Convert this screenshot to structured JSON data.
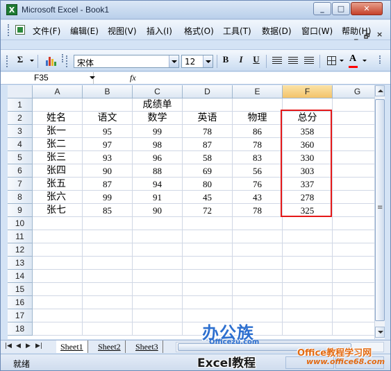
{
  "window": {
    "app_icon": "X",
    "title": "Microsoft Excel - Book1",
    "min_label": "_",
    "max_label": "□",
    "close_label": "✕"
  },
  "menu": {
    "items": [
      "文件(F)",
      "编辑(E)",
      "视图(V)",
      "插入(I)",
      "格式(O)",
      "工具(T)",
      "数据(D)",
      "窗口(W)",
      "帮助(H)"
    ],
    "ctrl_min": "_",
    "ctrl_restore": "🗗",
    "ctrl_close": "×"
  },
  "toolbar": {
    "autosum": "Σ",
    "font_name": "宋体",
    "font_size": "12",
    "bold": "B",
    "italic": "I",
    "underline": "U",
    "font_color_label": "A",
    "font_color_hex": "#ff0000"
  },
  "formula_bar": {
    "name_box": "F35",
    "fx": "fx"
  },
  "grid": {
    "columns": [
      "A",
      "B",
      "C",
      "D",
      "E",
      "F",
      "G"
    ],
    "selected_column": "F",
    "rows": [
      "1",
      "2",
      "3",
      "4",
      "5",
      "6",
      "7",
      "8",
      "9",
      "10",
      "11",
      "12",
      "13",
      "14",
      "15",
      "16",
      "17",
      "18"
    ],
    "title": "成绩单",
    "headers": [
      "姓名",
      "语文",
      "数学",
      "英语",
      "物理",
      "总分"
    ],
    "data": [
      [
        "张一",
        "95",
        "99",
        "78",
        "86",
        "358"
      ],
      [
        "张二",
        "97",
        "98",
        "87",
        "78",
        "360"
      ],
      [
        "张三",
        "93",
        "96",
        "58",
        "83",
        "330"
      ],
      [
        "张四",
        "90",
        "88",
        "69",
        "56",
        "303"
      ],
      [
        "张五",
        "87",
        "94",
        "80",
        "76",
        "337"
      ],
      [
        "张六",
        "99",
        "91",
        "45",
        "43",
        "278"
      ],
      [
        "张七",
        "85",
        "90",
        "72",
        "78",
        "325"
      ]
    ],
    "highlight_color": "#e51818"
  },
  "sheets": {
    "tabs": [
      "Sheet1",
      "Sheet2",
      "Sheet3"
    ],
    "active": "Sheet1"
  },
  "status": {
    "text": "就绪"
  },
  "watermarks": {
    "bangongzu": "办公族",
    "officezu_url": "Officezu.com",
    "excel_jiaocheng": "Excel教程",
    "office_site": "Office教程学习网",
    "office_site_url": "www.office68.com"
  }
}
